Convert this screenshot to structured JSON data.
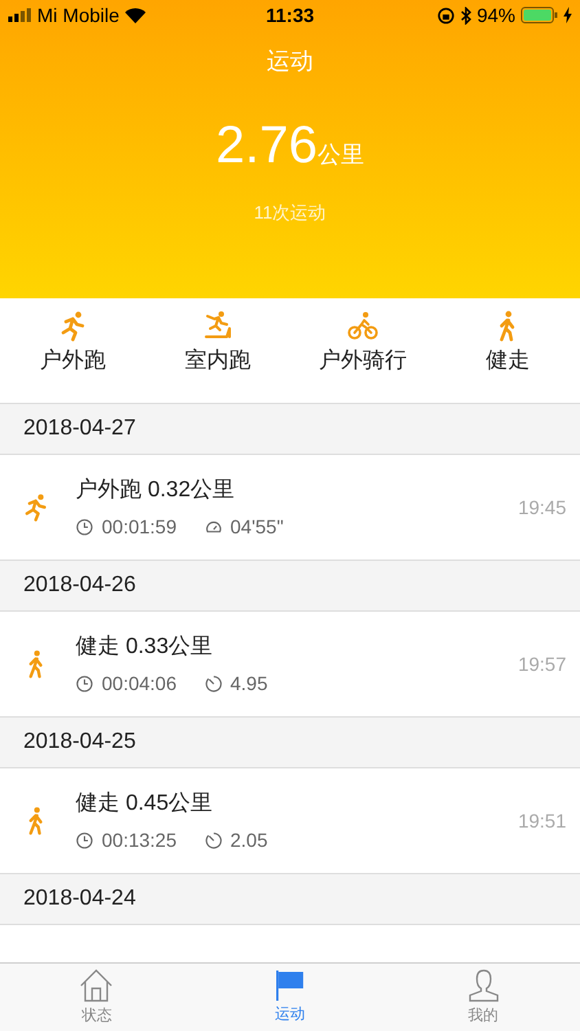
{
  "status_bar": {
    "carrier": "Mi Mobile",
    "time": "11:33",
    "battery": "94%"
  },
  "header": {
    "title": "运动",
    "distance": "2.76",
    "unit": "公里",
    "count": "11次运动"
  },
  "categories": [
    {
      "kind": "run",
      "label": "户外跑"
    },
    {
      "kind": "treadmill",
      "label": "室内跑"
    },
    {
      "kind": "bike",
      "label": "户外骑行"
    },
    {
      "kind": "walk",
      "label": "健走"
    }
  ],
  "days": [
    {
      "date": "2018-04-27",
      "records": [
        {
          "kind": "run",
          "title": "户外跑 0.32公里",
          "stats": [
            {
              "kind": "duration",
              "value": "00:01:59"
            },
            {
              "kind": "pace",
              "value": "04'55\""
            }
          ],
          "time": "19:45"
        }
      ]
    },
    {
      "date": "2018-04-26",
      "records": [
        {
          "kind": "walk",
          "title": "健走 0.33公里",
          "stats": [
            {
              "kind": "duration",
              "value": "00:04:06"
            },
            {
              "kind": "speed",
              "value": "4.95"
            }
          ],
          "time": "19:57"
        }
      ]
    },
    {
      "date": "2018-04-25",
      "records": [
        {
          "kind": "walk",
          "title": "健走 0.45公里",
          "stats": [
            {
              "kind": "duration",
              "value": "00:13:25"
            },
            {
              "kind": "speed",
              "value": "2.05"
            }
          ],
          "time": "19:51"
        }
      ]
    },
    {
      "date": "2018-04-24"
    }
  ],
  "tab_bar": [
    {
      "kind": "home",
      "label": "状态",
      "selected": false
    },
    {
      "kind": "flag",
      "label": "运动",
      "selected": true
    },
    {
      "kind": "person",
      "label": "我的",
      "selected": false
    }
  ]
}
